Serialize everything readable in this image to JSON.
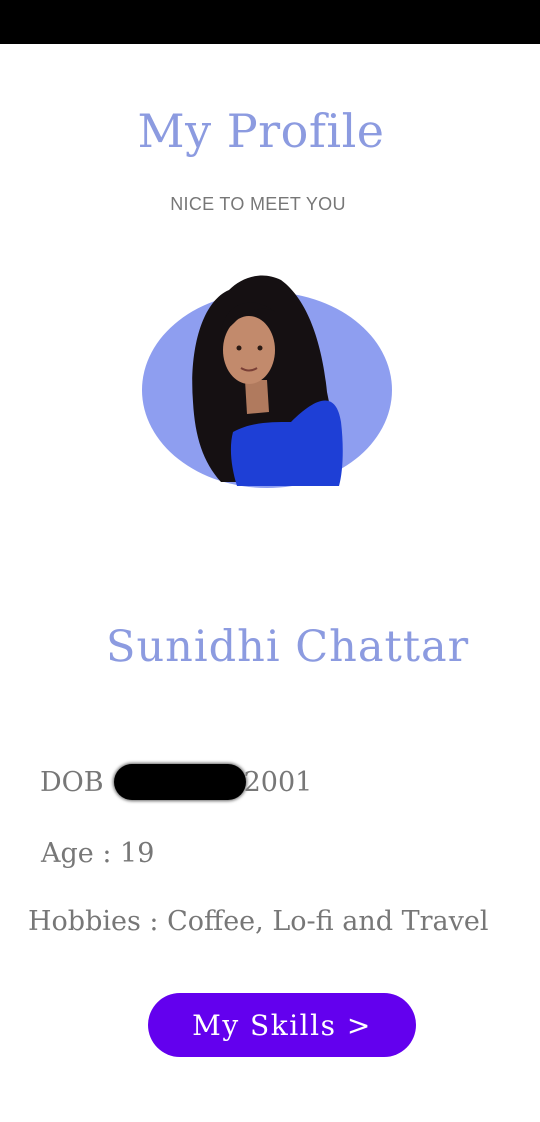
{
  "header": {
    "title": "My Profile",
    "subtitle": "NICE TO MEET YOU"
  },
  "profile": {
    "name": "Sunidhi Chattar",
    "dob_label": "DOB",
    "dob_year": "2001",
    "age": "Age : 19",
    "hobbies": "Hobbies : Coffee, Lo-fi and Travel"
  },
  "actions": {
    "skills_label": "My Skills >"
  },
  "colors": {
    "accent": "#8c9be0",
    "button": "#6300ee",
    "text_muted": "#777777",
    "avatar_bg": "#8e9ef0",
    "shirt": "#1e3fd6"
  }
}
